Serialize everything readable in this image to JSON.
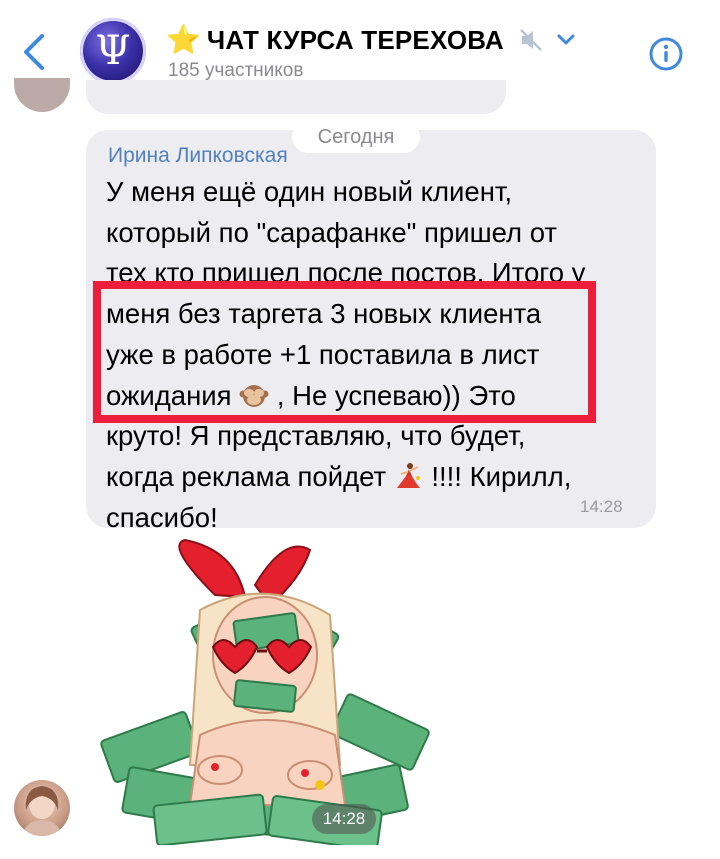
{
  "header": {
    "star": "⭐",
    "title": "ЧАТ КУРСА ТЕРЕХОВА",
    "subtitle": "185 участников",
    "avatar_glyph": "Ψ",
    "icons": {
      "back": "back-arrow-icon",
      "mute": "muted-speaker-icon",
      "expand": "chevron-down-icon",
      "info": "info-icon"
    }
  },
  "date_separator": "Сегодня",
  "message": {
    "sender": "Ирина Липковская",
    "lines": [
      "У меня ещё один новый клиент,",
      "который по \"сарафанке\" пришел от",
      "тех кто пришел после постов. Итого у",
      "меня без таргета 3 новых клиента",
      "уже в работе +1 поставила в лист",
      "ожидания",
      ", Не успеваю)) Это",
      "круто! Я представляю, что будет,",
      "когда реклама пойдет",
      "!!!! Кирилл,",
      "спасибо!"
    ],
    "time": "14:28"
  },
  "sticker": {
    "time": "14:28"
  },
  "colors": {
    "accent": "#5181b8",
    "highlight": "#ee1d3c",
    "bubble": "#ededf1"
  }
}
